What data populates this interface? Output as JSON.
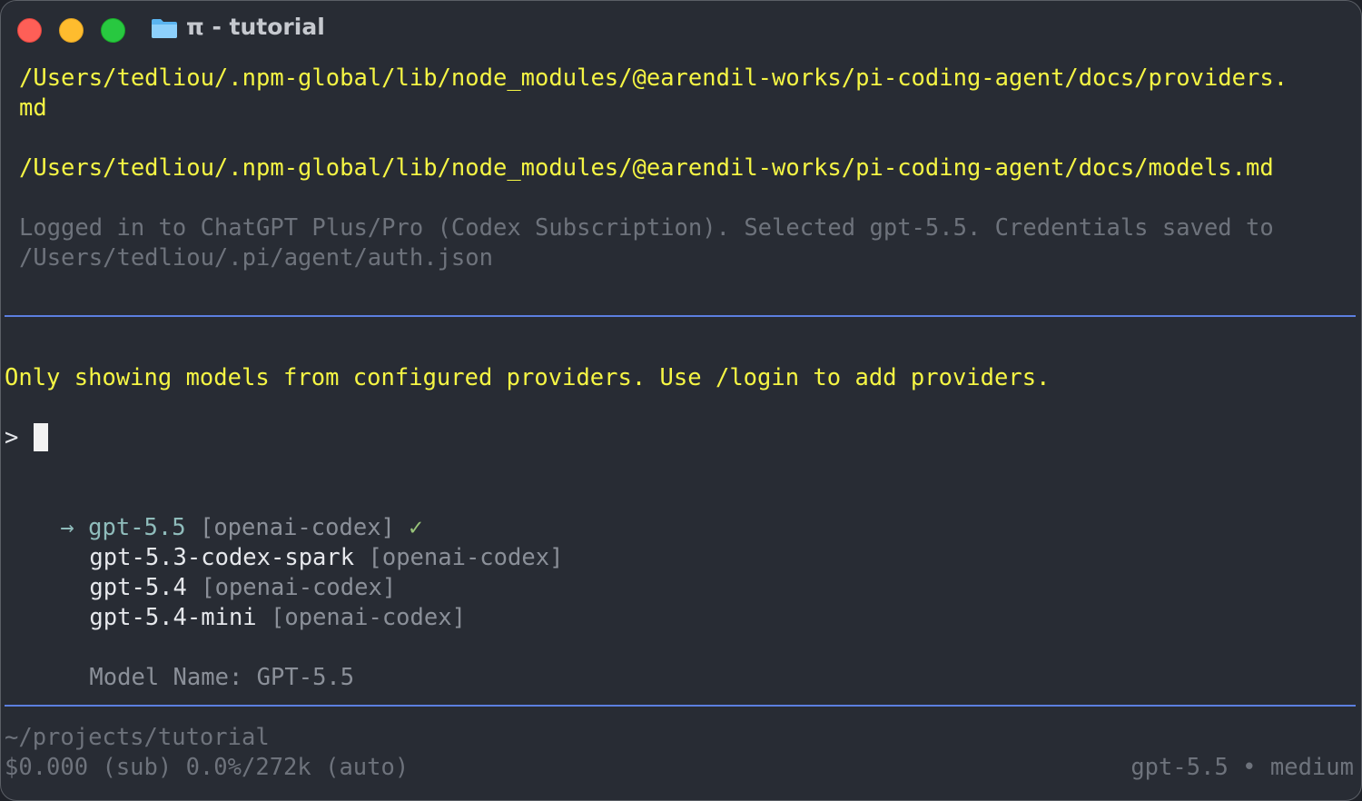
{
  "window": {
    "title": "π - tutorial"
  },
  "output": {
    "path1_line1": "/Users/tedliou/.npm-global/lib/node_modules/@earendil-works/pi-coding-agent/docs/providers.",
    "path1_line2": "md",
    "path2": "/Users/tedliou/.npm-global/lib/node_modules/@earendil-works/pi-coding-agent/docs/models.md",
    "login_line1": "Logged in to ChatGPT Plus/Pro (Codex Subscription). Selected gpt-5.5. Credentials saved to",
    "login_line2": "/Users/tedliou/.pi/agent/auth.json"
  },
  "selector": {
    "notice": "Only showing models from configured providers. Use /login to add providers.",
    "prompt": ">",
    "arrow": "→",
    "check": "✓",
    "models": [
      {
        "name": "gpt-5.5",
        "provider": "[openai-codex]",
        "selected": true
      },
      {
        "name": "gpt-5.3-codex-spark",
        "provider": "[openai-codex]",
        "selected": false
      },
      {
        "name": "gpt-5.4",
        "provider": "[openai-codex]",
        "selected": false
      },
      {
        "name": "gpt-5.4-mini",
        "provider": "[openai-codex]",
        "selected": false
      }
    ],
    "model_name_label": "Model Name:",
    "model_name_value": "GPT-5.5"
  },
  "footer": {
    "cwd": "~/projects/tutorial",
    "cost": "$0.000 (sub) 0.0%/272k (auto)",
    "model": "gpt-5.5",
    "separator": "•",
    "effort": "medium"
  },
  "colors": {
    "background": "#282c34",
    "accent_rule": "#5c7fe0",
    "yellow": "#f5f544",
    "dim": "#6e737c"
  }
}
